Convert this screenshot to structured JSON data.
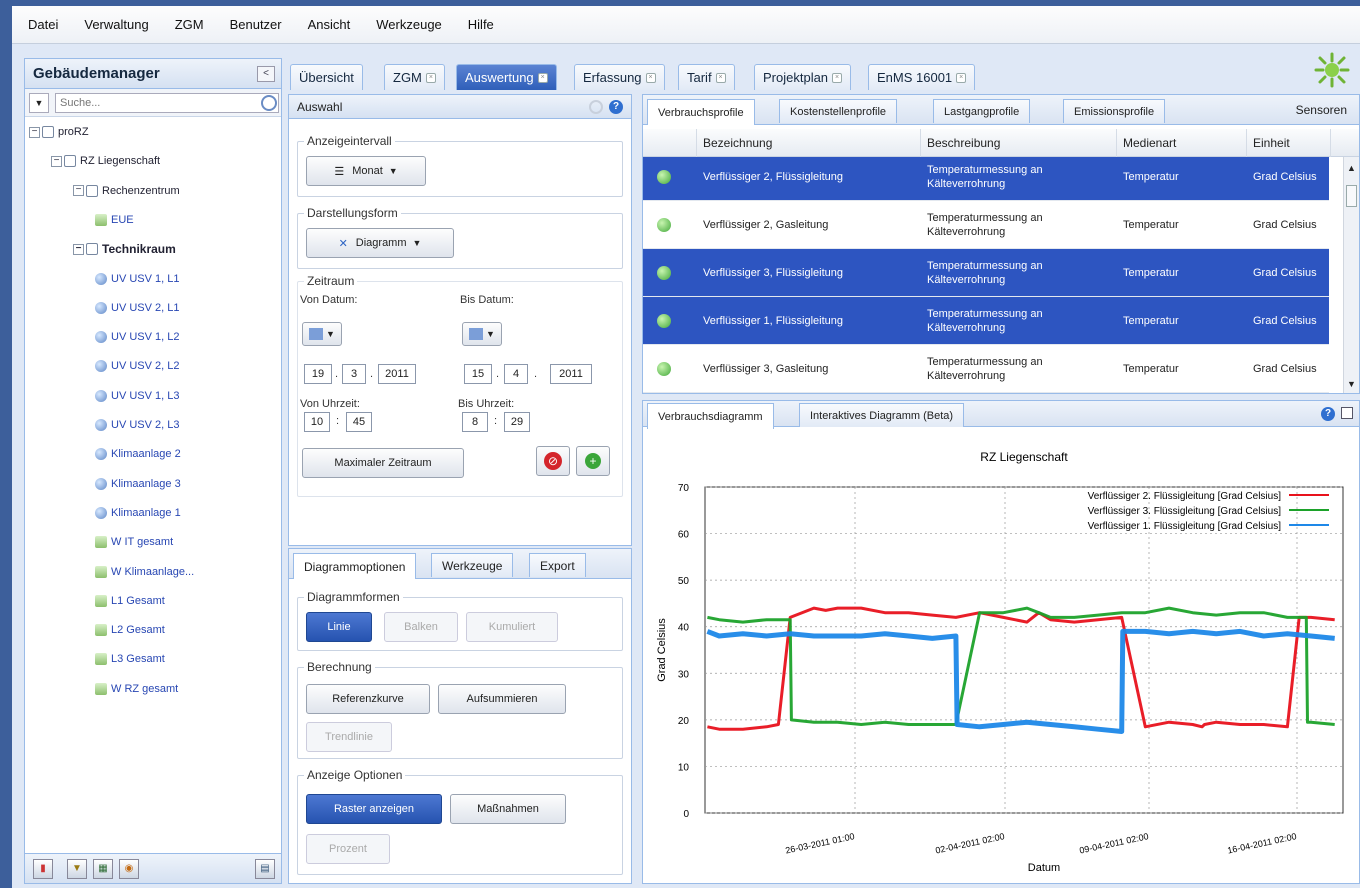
{
  "menu": [
    "Datei",
    "Verwaltung",
    "ZGM",
    "Benutzer",
    "Ansicht",
    "Werkzeuge",
    "Hilfe"
  ],
  "left_panel": {
    "title": "Gebäudemanager",
    "collapse_glyph": "<",
    "search_placeholder": "Suche...",
    "tree": [
      {
        "label": "proRZ",
        "level": 0,
        "type": "folder"
      },
      {
        "label": "RZ Liegenschaft",
        "level": 1,
        "type": "folder"
      },
      {
        "label": "Rechenzentrum",
        "level": 2,
        "type": "folder"
      },
      {
        "label": "EUE",
        "level": 3,
        "type": "leaf"
      },
      {
        "label": "Technikraum",
        "level": 2,
        "type": "folder"
      },
      {
        "label": "UV USV 1, L1",
        "level": 3,
        "type": "sensor"
      },
      {
        "label": "UV USV 2, L1",
        "level": 3,
        "type": "sensor"
      },
      {
        "label": "UV USV 1, L2",
        "level": 3,
        "type": "sensor"
      },
      {
        "label": "UV USV 2, L2",
        "level": 3,
        "type": "sensor"
      },
      {
        "label": "UV USV 1, L3",
        "level": 3,
        "type": "sensor"
      },
      {
        "label": "UV USV 2, L3",
        "level": 3,
        "type": "sensor"
      },
      {
        "label": "Klimaanlage 2",
        "level": 3,
        "type": "sensor"
      },
      {
        "label": "Klimaanlage 3",
        "level": 3,
        "type": "sensor"
      },
      {
        "label": "Klimaanlage 1",
        "level": 3,
        "type": "sensor"
      },
      {
        "label": "W IT gesamt",
        "level": 3,
        "type": "leaf"
      },
      {
        "label": "W Klimaanlage...",
        "level": 3,
        "type": "leaf"
      },
      {
        "label": "L1 Gesamt",
        "level": 3,
        "type": "leaf"
      },
      {
        "label": "L2 Gesamt",
        "level": 3,
        "type": "leaf"
      },
      {
        "label": "L3 Gesamt",
        "level": 3,
        "type": "leaf"
      },
      {
        "label": "W RZ gesamt",
        "level": 3,
        "type": "leaf"
      }
    ]
  },
  "tabs": [
    {
      "label": "Übersicht",
      "closable": false,
      "active": false
    },
    {
      "label": "ZGM",
      "closable": true,
      "active": false
    },
    {
      "label": "Auswertung",
      "closable": true,
      "active": true
    },
    {
      "label": "Erfassung",
      "closable": true,
      "active": false
    },
    {
      "label": "Tarif",
      "closable": true,
      "active": false
    },
    {
      "label": "Projektplan",
      "closable": true,
      "active": false
    },
    {
      "label": "EnMS 16001",
      "closable": true,
      "active": false
    }
  ],
  "auswahl": {
    "title": "Auswahl",
    "anzeigeintervall_label": "Anzeigeintervall",
    "interval_value": "Monat",
    "darstellungsform_label": "Darstellungsform",
    "darstellung_value": "Diagramm",
    "zeitraum_label": "Zeitraum",
    "von_datum_label": "Von Datum:",
    "bis_datum_label": "Bis Datum:",
    "von_day": "19",
    "von_month": "3",
    "von_year": "2011",
    "bis_day": "15",
    "bis_month": "4",
    "bis_year": "2011",
    "von_uhrzeit_label": "Von Uhrzeit:",
    "bis_uhrzeit_label": "Bis Uhrzeit:",
    "von_hour": "10",
    "von_min": "45",
    "bis_hour": "8",
    "bis_min": "29",
    "time_sep": ":",
    "date_sep": ".",
    "max_zeitraum_label": "Maximaler Zeitraum"
  },
  "options": {
    "tabs": [
      "Diagrammoptionen",
      "Werkzeuge",
      "Export"
    ],
    "diagrammformen_label": "Diagrammformen",
    "linie": "Linie",
    "balken": "Balken",
    "kumuliert": "Kumuliert",
    "berechnung_label": "Berechnung",
    "referenzkurve": "Referenzkurve",
    "aufsummieren": "Aufsummieren",
    "trendlinie": "Trendlinie",
    "anzeige_optionen_label": "Anzeige Optionen",
    "raster": "Raster anzeigen",
    "massnahmen": "Maßnahmen",
    "prozent": "Prozent"
  },
  "profiles": {
    "tabs": [
      "Verbrauchsprofile",
      "Kostenstellenprofile",
      "Lastgangprofile",
      "Emissionsprofile"
    ],
    "sensoren_label": "Sensoren",
    "columns": [
      "Bezeichnung",
      "Beschreibung",
      "Medienart",
      "Einheit"
    ],
    "rows": [
      {
        "bezeichnung": "Verflüssiger 2, Flüssigleitung",
        "beschreibung": "Temperaturmessung an Kälteverrohrung",
        "medienart": "Temperatur",
        "einheit": "Grad Celsius",
        "selected": true
      },
      {
        "bezeichnung": "Verflüssiger 2, Gasleitung",
        "beschreibung": "Temperaturmessung an Kälteverrohrung",
        "medienart": "Temperatur",
        "einheit": "Grad Celsius",
        "selected": false
      },
      {
        "bezeichnung": "Verflüssiger 3, Flüssigleitung",
        "beschreibung": "Temperaturmessung an Kälteverrohrung",
        "medienart": "Temperatur",
        "einheit": "Grad Celsius",
        "selected": true
      },
      {
        "bezeichnung": "Verflüssiger 1, Flüssigleitung",
        "beschreibung": "Temperaturmessung an Kälteverrohrung",
        "medienart": "Temperatur",
        "einheit": "Grad Celsius",
        "selected": true
      },
      {
        "bezeichnung": "Verflüssiger 3, Gasleitung",
        "beschreibung": "Temperaturmessung an Kälteverrohrung",
        "medienart": "Temperatur",
        "einheit": "Grad Celsius",
        "selected": false
      }
    ]
  },
  "diagram_tabs": [
    "Verbrauchsdiagramm",
    "Interaktives Diagramm (Beta)"
  ],
  "colors": {
    "accent": "#2d55c1",
    "red": "#e8121c",
    "green": "#1ca22a",
    "blue": "#1e88e8"
  },
  "chart_data": {
    "type": "line",
    "title": "RZ Liegenschaft",
    "xlabel": "Datum",
    "ylabel": "Grad Celsius",
    "ylim": [
      0,
      70
    ],
    "yticks": [
      0,
      10,
      20,
      30,
      40,
      50,
      60,
      70
    ],
    "xticks": [
      "26-03-2011 01:00",
      "02-04-2011 02:00",
      "09-04-2011 02:00",
      "16-04-2011 02:00"
    ],
    "x_range_days": [
      19.4,
      46.35
    ],
    "grid": true,
    "legend_position": "top-right",
    "series": [
      {
        "name": "Verflüssiger 2. Flüssigleitung [Grad Celsius]",
        "color": "#e8121c",
        "x_days": [
          19.5,
          20,
          21,
          22,
          22.5,
          23,
          24,
          24.5,
          25,
          26,
          27,
          28,
          29,
          30,
          31,
          32,
          33,
          33.5,
          34,
          35,
          36,
          37,
          38,
          39,
          40,
          40.4,
          40.5,
          41,
          42,
          43,
          44,
          44.5,
          45,
          46
        ],
        "values": [
          18.5,
          18,
          18,
          18.5,
          19,
          42,
          44,
          43.5,
          44,
          44,
          43,
          43,
          42.5,
          42,
          43,
          42,
          41,
          43,
          41.5,
          41,
          41.5,
          42,
          18.5,
          19.5,
          19,
          18.5,
          19,
          19.5,
          19,
          19,
          18.5,
          42,
          42,
          41.5
        ]
      },
      {
        "name": "Verflüssiger 3. Flüssigleitung [Grad Celsius]",
        "color": "#1ca22a",
        "x_days": [
          19.5,
          20,
          21,
          22,
          23,
          23.05,
          24,
          25,
          26,
          27,
          28,
          29,
          30,
          31,
          32,
          33,
          33.5,
          34,
          35,
          36,
          37,
          38,
          39,
          40,
          41,
          42,
          43,
          44,
          44.8,
          44.85,
          45,
          46
        ],
        "values": [
          42,
          41.5,
          41,
          41.5,
          41.5,
          20,
          19.5,
          19.5,
          19,
          19.5,
          19,
          19,
          19,
          43,
          43,
          44,
          43,
          42,
          42,
          42.5,
          43,
          43,
          44,
          43,
          42.5,
          43,
          43,
          42,
          42,
          19.5,
          19.5,
          19
        ]
      },
      {
        "name": "Verflüssiger 1. Flüssigleitung [Grad Celsius]",
        "color": "#1e88e8",
        "x_days": [
          19.5,
          20,
          21,
          22,
          23,
          24,
          25,
          26,
          27,
          28,
          29,
          30,
          30.05,
          31,
          32,
          33,
          34,
          35,
          36,
          37,
          37.05,
          38,
          39,
          40,
          41,
          42,
          43,
          44,
          45,
          46
        ],
        "values": [
          39,
          38,
          38.5,
          38,
          38.5,
          38,
          38,
          38,
          38.5,
          38,
          37.5,
          38,
          19,
          18.5,
          19,
          19.5,
          19,
          18.5,
          18,
          17.5,
          39,
          39,
          38.5,
          39,
          38.5,
          39,
          38,
          38.5,
          38,
          37.5
        ]
      }
    ]
  }
}
